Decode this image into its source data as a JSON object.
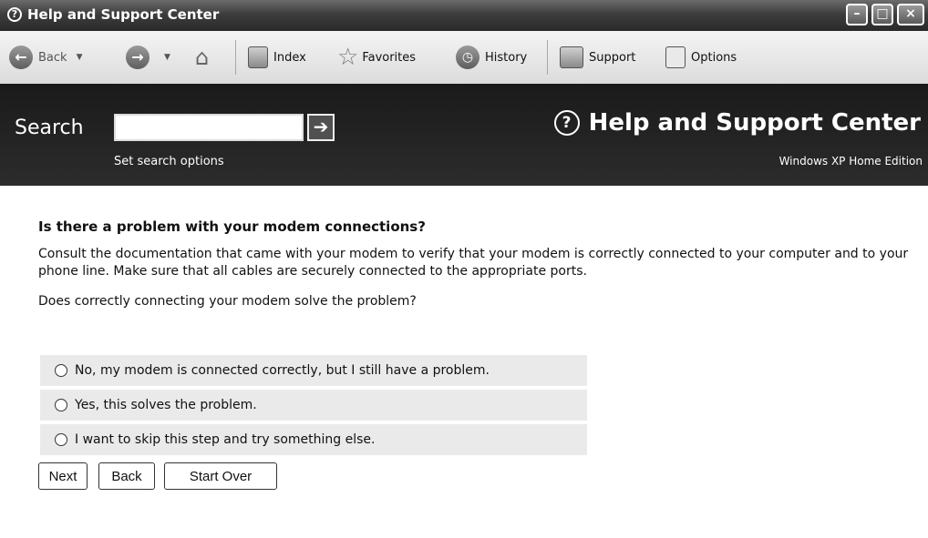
{
  "window": {
    "title": "Help and Support Center"
  },
  "toolbar": {
    "back": "Back",
    "index": "Index",
    "favorites": "Favorites",
    "history": "History",
    "support": "Support",
    "options": "Options"
  },
  "search": {
    "label": "Search",
    "value": "",
    "options_link": "Set search options"
  },
  "brand": {
    "title": "Help and Support Center",
    "edition": "Windows XP Home Edition"
  },
  "main": {
    "question": "Is there a problem with your modem connections?",
    "paragraph": "Consult the documentation that came with your modem to verify that your modem is correctly connected to your computer and to your phone line. Make sure that all cables are securely connected to the appropriate ports.",
    "prompt": "Does correctly connecting your modem solve the problem?",
    "options": [
      "No, my modem is connected correctly, but I still have a problem.",
      "Yes, this solves the problem.",
      "I want to skip this step and try something else."
    ],
    "buttons": {
      "next": "Next",
      "back": "Back",
      "start_over": "Start Over"
    }
  }
}
